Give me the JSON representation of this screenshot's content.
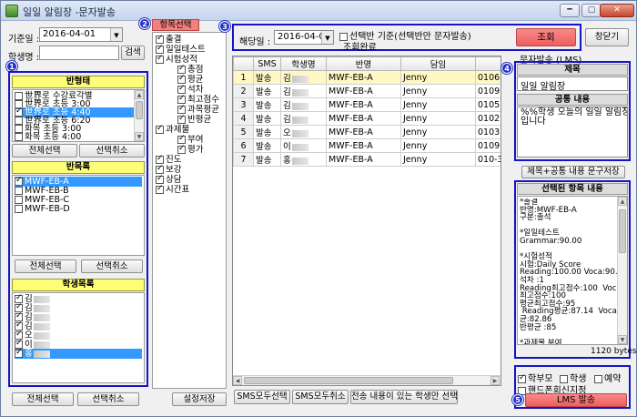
{
  "window": {
    "title": "일일 알림장 -문자발송"
  },
  "window_controls": {
    "minimize": "━",
    "maximize": "▢",
    "close": "✕"
  },
  "date_filter": {
    "label": "기준일 :",
    "value": "2016-04-01"
  },
  "student_search": {
    "label": "학생명 :",
    "value": "",
    "button": "검색"
  },
  "badges": [
    "1",
    "2",
    "3",
    "4",
    "5"
  ],
  "class_type": {
    "header": "반형태",
    "items": [
      {
        "label": "世界로 수강료각별",
        "checked": false
      },
      {
        "label": "世界로 초등 3:00",
        "checked": false
      },
      {
        "label": "世界로 초등 4:40",
        "checked": true,
        "selected": true
      },
      {
        "label": "世界로 초등 6:20",
        "checked": false
      },
      {
        "label": "화목 초등 3:00",
        "checked": false
      },
      {
        "label": "화목 초등 4:00",
        "checked": false
      }
    ],
    "select_all": "전체선택",
    "deselect": "선택취소"
  },
  "class_list": {
    "header": "반목록",
    "items": [
      {
        "label": "MWF-EB-A",
        "checked": true,
        "selected": true
      },
      {
        "label": "MWF-EB-B",
        "checked": false
      },
      {
        "label": "MWF-EB-C",
        "checked": false
      },
      {
        "label": "MWF-EB-D",
        "checked": false
      }
    ],
    "select_all": "전체선택",
    "deselect": "선택취소"
  },
  "student_list": {
    "header": "학생목록",
    "items": [
      {
        "label": "김",
        "checked": true
      },
      {
        "label": "김",
        "checked": true
      },
      {
        "label": "김",
        "checked": true
      },
      {
        "label": "김",
        "checked": true
      },
      {
        "label": "오",
        "checked": true
      },
      {
        "label": "이",
        "checked": true
      },
      {
        "label": "홍",
        "checked": true,
        "selected": true
      }
    ],
    "select_all": "전체선택",
    "deselect": "선택취소"
  },
  "item_select": {
    "header": "항목선택",
    "tree": [
      {
        "label": "출결",
        "checked": true,
        "level": 0
      },
      {
        "label": "일일테스트",
        "checked": true,
        "level": 0
      },
      {
        "label": "시험성적",
        "checked": true,
        "level": 0
      },
      {
        "label": "총점",
        "checked": true,
        "level": 2
      },
      {
        "label": "평균",
        "checked": true,
        "level": 2
      },
      {
        "label": "석차",
        "checked": true,
        "level": 2
      },
      {
        "label": "최고점수",
        "checked": true,
        "level": 2
      },
      {
        "label": "과목평균",
        "checked": true,
        "level": 2
      },
      {
        "label": "반평균",
        "checked": true,
        "level": 2
      },
      {
        "label": "과제물",
        "checked": true,
        "level": 0
      },
      {
        "label": "부여",
        "checked": true,
        "level": 2
      },
      {
        "label": "평가",
        "checked": true,
        "level": 2
      },
      {
        "label": "진도",
        "checked": true,
        "level": 0
      },
      {
        "label": "보강",
        "checked": true,
        "level": 0
      },
      {
        "label": "상담",
        "checked": true,
        "level": 0
      },
      {
        "label": "시간표",
        "checked": true,
        "level": 0
      }
    ],
    "save_button": "설정저장"
  },
  "query_bar": {
    "date_label": "해당일 :",
    "date_value": "2016-04-01",
    "option_label": "선택반 기준(선택반만 문자발송)",
    "option_checked": false,
    "status": "조회완료",
    "query_button": "조회",
    "close_button": "창닫기"
  },
  "grid": {
    "columns": [
      "",
      "SMS",
      "학생명",
      "반명",
      "담임",
      ""
    ],
    "rows": [
      {
        "n": "1",
        "sms": "발송",
        "name": "김",
        "cls": "MWF-EB-A",
        "teacher": "Jenny",
        "phone": "0106",
        "highlight": true
      },
      {
        "n": "2",
        "sms": "발송",
        "name": "김",
        "cls": "MWF-EB-A",
        "teacher": "Jenny",
        "phone": "0109",
        "highlight": false
      },
      {
        "n": "3",
        "sms": "발송",
        "name": "김",
        "cls": "MWF-EB-A",
        "teacher": "Jenny",
        "phone": "0105",
        "highlight": false
      },
      {
        "n": "4",
        "sms": "발송",
        "name": "김",
        "cls": "MWF-EB-A",
        "teacher": "Jenny",
        "phone": "0102",
        "highlight": false
      },
      {
        "n": "5",
        "sms": "발송",
        "name": "오",
        "cls": "MWF-EB-A",
        "teacher": "Jenny",
        "phone": "0103",
        "highlight": false
      },
      {
        "n": "6",
        "sms": "발송",
        "name": "이",
        "cls": "MWF-EB-A",
        "teacher": "Jenny",
        "phone": "0109",
        "highlight": false
      },
      {
        "n": "7",
        "sms": "발송",
        "name": "홍",
        "cls": "MWF-EB-A",
        "teacher": "Jenny",
        "phone": "010-3",
        "highlight": false
      }
    ]
  },
  "bottom_buttons": {
    "sms_all": "SMS모두선택",
    "sms_cancel": "SMS모두취소",
    "only_with_content": "전송 내용이 있는 학생만 선택"
  },
  "message": {
    "section_label": "문자발송 (LMS)",
    "title_header": "제목",
    "title_value": "일일 알림장",
    "common_header": "공통 내용",
    "common_value": "%%학생 오늘의 일일 알림장\n입니다",
    "save_button": "제목+공통 내용 문구저장",
    "selected_header": "선택된 항목 내용",
    "selected_content": "*출결\n반명:MWF-EB-A\n구분:출석\n\n*일일테스트\nGrammar:90.00\n\n*시험성적\n시험:Daily Score\nReading:100.00 Voca:90.00\n석차 :1\nReading최고점수:100  Voca\n최고점수:100\n평균최고점수:95\n Reading평균:87.14  Voca평\n균:82.86\n반평균 :85\n\n*과제물 부여",
    "bytes": "1120 bytes"
  },
  "send_options": {
    "parent": {
      "label": "학부모",
      "checked": true
    },
    "student": {
      "label": "학생",
      "checked": false
    },
    "reserve": {
      "label": "예약",
      "checked": false
    },
    "handphone": {
      "label": "핸드폰회신지정",
      "checked": false
    },
    "send_button": "LMS 발송"
  }
}
